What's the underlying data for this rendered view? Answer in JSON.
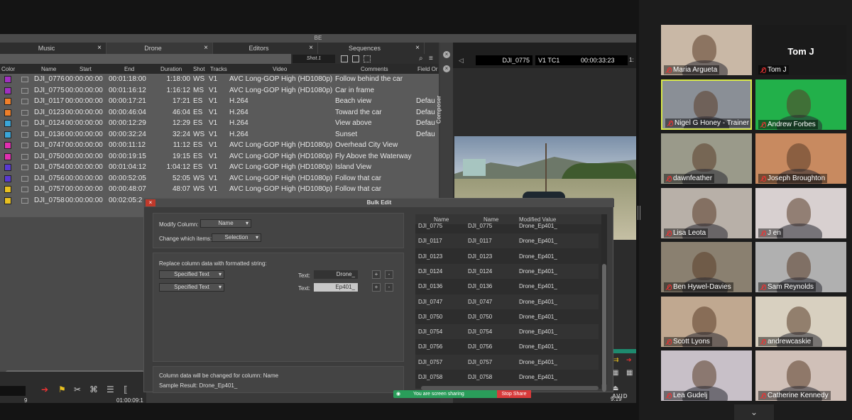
{
  "window_title": "BE",
  "tabs": [
    {
      "label": "Music"
    },
    {
      "label": "Drone"
    },
    {
      "label": "Editors"
    },
    {
      "label": "Sequences"
    }
  ],
  "toolbar": {
    "shot": "Shot.1"
  },
  "columns": [
    "Color",
    "Name",
    "Start",
    "End",
    "Duration",
    "Shot",
    "Tracks",
    "Video",
    "Comments",
    "Field Or"
  ],
  "rows": [
    {
      "color": "#a030c0",
      "name": "DJI_0776",
      "start": "00:00:00:00",
      "end": "00:01:18:00",
      "dur": "1:18:00",
      "shot": "WS",
      "tracks": "V1",
      "video": "AVC Long-GOP High (HD1080p)",
      "comment": "Follow behind the car",
      "field": ""
    },
    {
      "color": "#a030c0",
      "name": "DJI_0775",
      "start": "00:00:00:00",
      "end": "00:01:16:12",
      "dur": "1:16:12",
      "shot": "MS",
      "tracks": "V1",
      "video": "AVC Long-GOP High (HD1080p)",
      "comment": "Car in frame",
      "field": ""
    },
    {
      "color": "#f07f2a",
      "name": "DJI_0117",
      "start": "00:00:00:00",
      "end": "00:00:17:21",
      "dur": "17:21",
      "shot": "ES",
      "tracks": "V1",
      "video": "H.264",
      "comment": "Beach view",
      "field": "Defau"
    },
    {
      "color": "#f07f2a",
      "name": "DJI_0123",
      "start": "00:00:00:00",
      "end": "00:00:46:04",
      "dur": "46:04",
      "shot": "ES",
      "tracks": "V1",
      "video": "H.264",
      "comment": "Toward the car",
      "field": "Defau"
    },
    {
      "color": "#3aa6d8",
      "name": "DJI_0124",
      "start": "00:00:00:00",
      "end": "00:00:12:29",
      "dur": "12:29",
      "shot": "ES",
      "tracks": "V1",
      "video": "H.264",
      "comment": "View above",
      "field": "Defau"
    },
    {
      "color": "#3aa6d8",
      "name": "DJI_0136",
      "start": "00:00:00:00",
      "end": "00:00:32:24",
      "dur": "32:24",
      "shot": "WS",
      "tracks": "V1",
      "video": "H.264",
      "comment": "Sunset",
      "field": "Defau"
    },
    {
      "color": "#e02fb0",
      "name": "DJI_0747",
      "start": "00:00:00:00",
      "end": "00:00:11:12",
      "dur": "11:12",
      "shot": "ES",
      "tracks": "V1",
      "video": "AVC Long-GOP High (HD1080p)",
      "comment": "Overhead City View",
      "field": ""
    },
    {
      "color": "#e02fb0",
      "name": "DJI_0750",
      "start": "00:00:00:00",
      "end": "00:00:19:15",
      "dur": "19:15",
      "shot": "ES",
      "tracks": "V1",
      "video": "AVC Long-GOP High (HD1080p)",
      "comment": "Fly Above the Waterway",
      "field": ""
    },
    {
      "color": "#5a3ad0",
      "name": "DJI_0754",
      "start": "00:00:00:00",
      "end": "00:01:04:12",
      "dur": "1:04:12",
      "shot": "ES",
      "tracks": "V1",
      "video": "AVC Long-GOP High (HD1080p)",
      "comment": "Island View",
      "field": ""
    },
    {
      "color": "#5a3ad0",
      "name": "DJI_0756",
      "start": "00:00:00:00",
      "end": "00:00:52:05",
      "dur": "52:05",
      "shot": "WS",
      "tracks": "V1",
      "video": "AVC Long-GOP High (HD1080p)",
      "comment": "Follow that car",
      "field": ""
    },
    {
      "color": "#e8c020",
      "name": "DJI_0757",
      "start": "00:00:00:00",
      "end": "00:00:48:07",
      "dur": "48:07",
      "shot": "WS",
      "tracks": "V1",
      "video": "AVC Long-GOP High (HD1080p)",
      "comment": "Follow that car",
      "field": ""
    },
    {
      "color": "#e8c020",
      "name": "DJI_0758",
      "start": "00:00:00:00",
      "end": "00:02:05:2",
      "dur": "",
      "shot": "",
      "tracks": "",
      "video": "",
      "comment": "",
      "field": ""
    }
  ],
  "lower_left": {
    "tc_left": "9",
    "tc_right": "01:00:09:1"
  },
  "composer": {
    "label": "Composer",
    "clip": "DJI_0775",
    "track": "V1   TC1",
    "timecode": "00:00:33:23",
    "side_tc": "1:",
    "tc_bottom": "9:19"
  },
  "bulk_edit": {
    "title": "Bulk Edit",
    "modify_label": "Modify Column:",
    "modify_value": "Name",
    "which_label": "Change which items:",
    "which_value": "Selection",
    "replace_label": "Replace column data with formatted string:",
    "spec1": "Specified Text",
    "spec2": "Specified Text",
    "text_label": "Text:",
    "text1": "Drone_",
    "text2": "Ep401_",
    "plus": "+",
    "minus": "-",
    "footer1": "Column data will be changed for column: Name",
    "footer2": "Sample Result:  Drone_Ep401_",
    "table_headers": [
      "Name",
      "Name",
      "Modified Value"
    ],
    "table_rows": [
      [
        "DJI_0775",
        "DJI_0775",
        "Drone_Ep401_"
      ],
      [
        "DJI_0117",
        "DJI_0117",
        "Drone_Ep401_"
      ],
      [
        "DJI_0123",
        "DJI_0123",
        "Drone_Ep401_"
      ],
      [
        "DJI_0124",
        "DJI_0124",
        "Drone_Ep401_"
      ],
      [
        "DJI_0136",
        "DJI_0136",
        "Drone_Ep401_"
      ],
      [
        "DJI_0747",
        "DJI_0747",
        "Drone_Ep401_"
      ],
      [
        "DJI_0750",
        "DJI_0750",
        "Drone_Ep401_"
      ],
      [
        "DJI_0754",
        "DJI_0754",
        "Drone_Ep401_"
      ],
      [
        "DJI_0756",
        "DJI_0756",
        "Drone_Ep401_"
      ],
      [
        "DJI_0757",
        "DJI_0757",
        "Drone_Ep401_"
      ],
      [
        "DJI_0758",
        "DJI_0758",
        "Drone_Ep401_"
      ]
    ]
  },
  "screen_share": {
    "status": "You are screen sharing",
    "stop": "Stop Share"
  },
  "avid_logo": "AVID",
  "participants": [
    {
      "name": "Maria Argueta",
      "bg": "#c9b8a6",
      "video": true
    },
    {
      "name": "Tom J",
      "bg": "#1a1a1a",
      "video": false
    },
    {
      "name": "Nigel G Honey - Trainer",
      "bg": "#8a8f96",
      "video": true,
      "active": true
    },
    {
      "name": "Andrew Forbes",
      "bg": "#22b04a",
      "video": true
    },
    {
      "name": "dawnfeather",
      "bg": "#9a9a8a",
      "video": true
    },
    {
      "name": "Joseph Broughton",
      "bg": "#c88a60",
      "video": true
    },
    {
      "name": "Lisa Leota",
      "bg": "#b8b0a8",
      "video": true
    },
    {
      "name": "J en",
      "bg": "#d8d0d0",
      "video": true
    },
    {
      "name": "Ben Hywel-Davies",
      "bg": "#8a8070",
      "video": true
    },
    {
      "name": "Sam Reynolds",
      "bg": "#b0b0b0",
      "video": true
    },
    {
      "name": "Scott Lyons",
      "bg": "#c0a890",
      "video": true
    },
    {
      "name": "andrewcaskie",
      "bg": "#d8d0c0",
      "video": true
    },
    {
      "name": "Lea Gudelj",
      "bg": "#c8c0c8",
      "video": true
    },
    {
      "name": "Catherine Kennedy",
      "bg": "#d0c0b8",
      "video": true
    }
  ],
  "colors": {
    "accent": "#2a9d5a",
    "stop": "#d83a3a",
    "active_border": "#d8e84a"
  }
}
